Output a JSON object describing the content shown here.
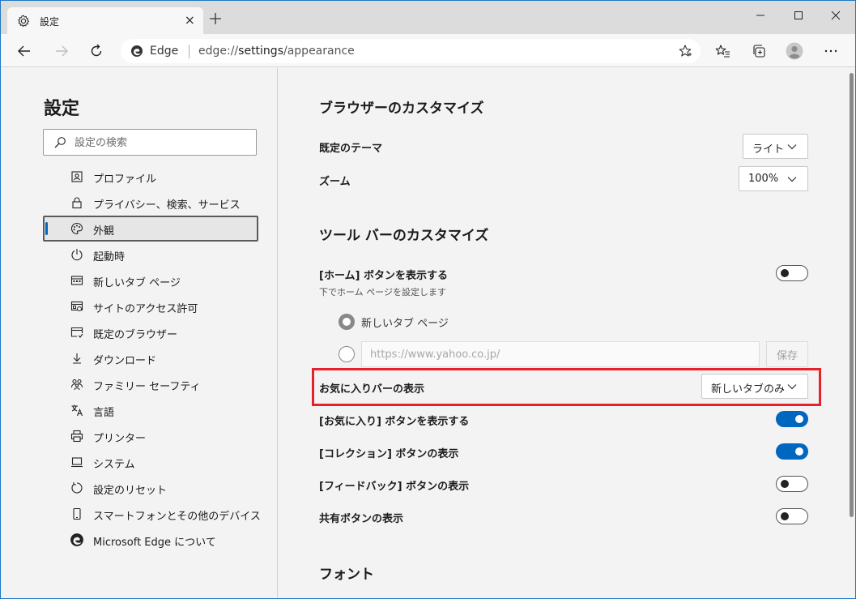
{
  "tab": {
    "title": "設定",
    "close": "×"
  },
  "address": {
    "site_name": "Edge",
    "url_prefix": "edge://",
    "url_bold": "settings",
    "url_suffix": "/appearance"
  },
  "sidebar": {
    "title": "設定",
    "search_placeholder": "設定の検索",
    "items": [
      {
        "label": "プロファイル",
        "icon": "profile-icon"
      },
      {
        "label": "プライバシー、検索、サービス",
        "icon": "lock-icon"
      },
      {
        "label": "外観",
        "icon": "palette-icon",
        "active": true
      },
      {
        "label": "起動時",
        "icon": "power-icon"
      },
      {
        "label": "新しいタブ ページ",
        "icon": "newtab-icon"
      },
      {
        "label": "サイトのアクセス許可",
        "icon": "site-permissions-icon"
      },
      {
        "label": "既定のブラウザー",
        "icon": "default-browser-icon"
      },
      {
        "label": "ダウンロード",
        "icon": "download-icon"
      },
      {
        "label": "ファミリー セーフティ",
        "icon": "family-icon"
      },
      {
        "label": "言語",
        "icon": "language-icon"
      },
      {
        "label": "プリンター",
        "icon": "printer-icon"
      },
      {
        "label": "システム",
        "icon": "system-icon"
      },
      {
        "label": "設定のリセット",
        "icon": "reset-icon"
      },
      {
        "label": "スマートフォンとその他のデバイス",
        "icon": "phone-icon"
      },
      {
        "label": "Microsoft Edge について",
        "icon": "edge-icon"
      }
    ]
  },
  "main": {
    "browser_customize": {
      "heading": "ブラウザーのカスタマイズ",
      "theme_label": "既定のテーマ",
      "theme_value": "ライト",
      "zoom_label": "ズーム",
      "zoom_value": "100%"
    },
    "toolbar_customize": {
      "heading": "ツール バーのカスタマイズ",
      "home_label": "[ホーム] ボタンを表示する",
      "home_sub": "下でホーム ページを設定します",
      "home_on": false,
      "radio_newtab": "新しいタブ ページ",
      "url_placeholder": "https://www.yahoo.co.jp/",
      "save_label": "保存",
      "favbar_label": "お気に入りバーの表示",
      "favbar_value": "新しいタブのみ",
      "favbtn_label": "[お気に入り] ボタンを表示する",
      "favbtn_on": true,
      "collection_label": "[コレクション] ボタンの表示",
      "collection_on": true,
      "feedback_label": "[フィードバック] ボタンの表示",
      "feedback_on": false,
      "share_label": "共有ボタンの表示",
      "share_on": false
    },
    "fonts": {
      "heading": "フォント"
    }
  },
  "colors": {
    "accent": "#0067c0",
    "highlight": "#e8202a",
    "frame": "#1e78c8"
  }
}
